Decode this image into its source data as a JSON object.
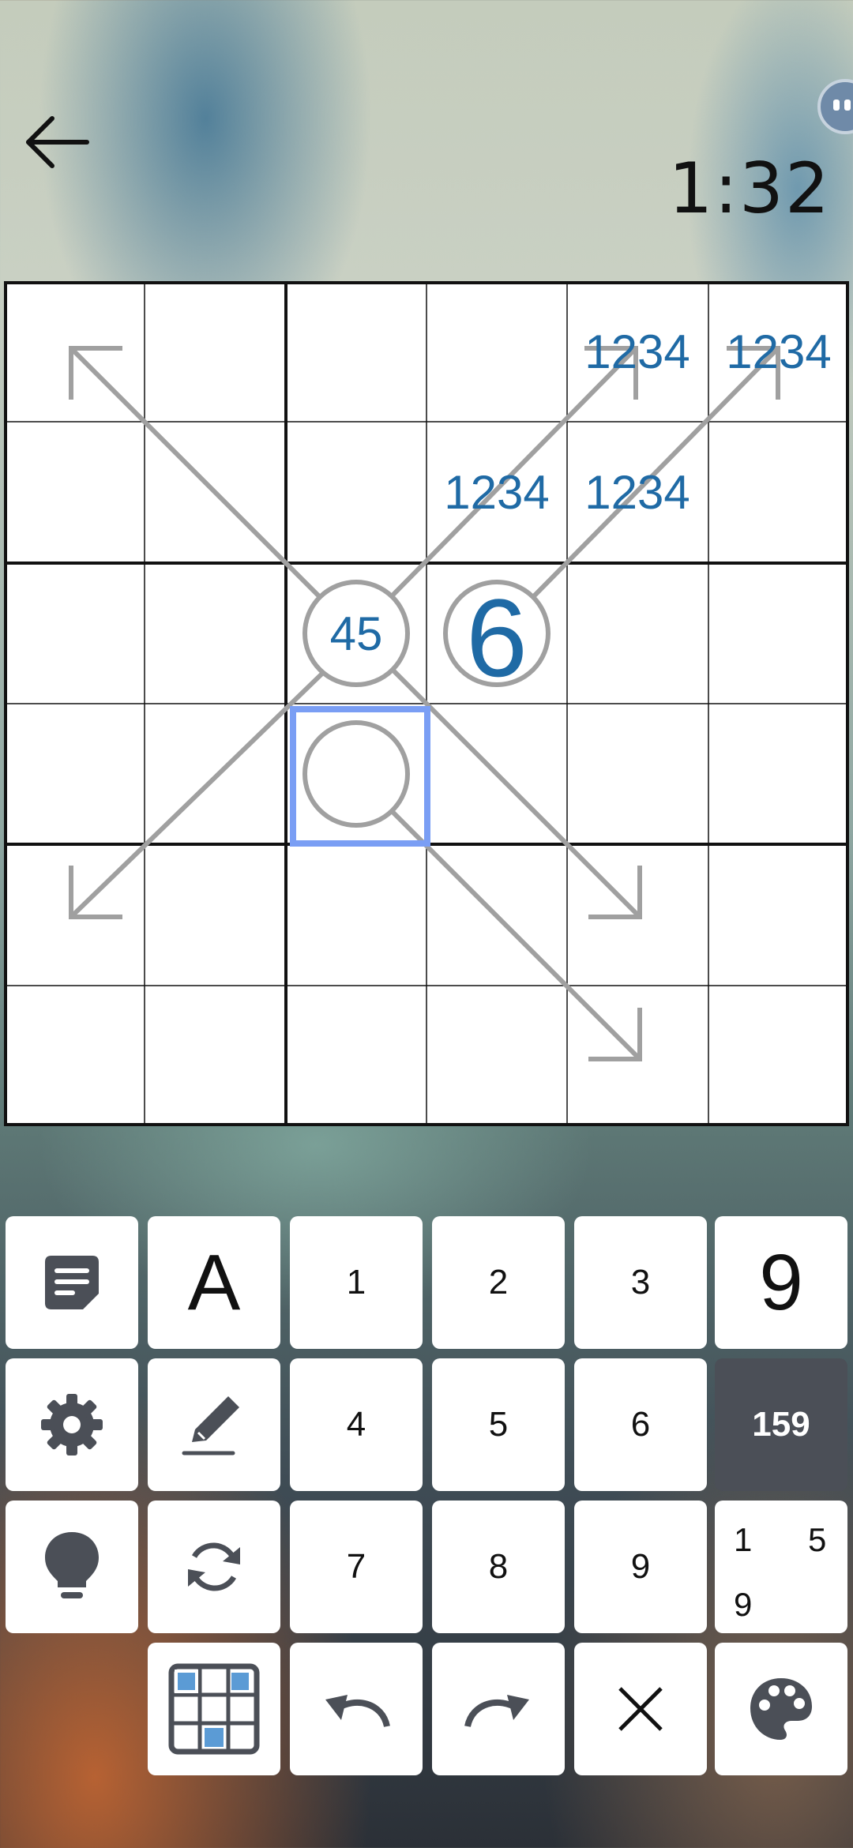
{
  "header": {
    "timer": "1:32",
    "back_icon": "arrow-left-icon",
    "avatar_icon": "robot-avatar-icon"
  },
  "board": {
    "size": 6,
    "cells": [
      {
        "row": 0,
        "col": 4,
        "notes": "1234"
      },
      {
        "row": 0,
        "col": 5,
        "notes": "1234"
      },
      {
        "row": 1,
        "col": 3,
        "notes": "1234"
      },
      {
        "row": 1,
        "col": 4,
        "notes": "1234"
      },
      {
        "row": 2,
        "col": 2,
        "notes": "45"
      },
      {
        "row": 2,
        "col": 3,
        "value": "6"
      }
    ],
    "circles": [
      {
        "row": 2,
        "col": 2
      },
      {
        "row": 2,
        "col": 3
      },
      {
        "row": 3,
        "col": 2
      }
    ],
    "arrows": [
      {
        "from": [
          2,
          2
        ],
        "to": [
          0,
          0
        ],
        "direction": "up-left"
      },
      {
        "from": [
          2,
          2
        ],
        "to": [
          0,
          4
        ],
        "direction": "up-right"
      },
      {
        "from": [
          2,
          3
        ],
        "to": [
          0,
          5
        ],
        "direction": "up-right"
      },
      {
        "from": [
          2,
          2
        ],
        "to": [
          4,
          0
        ],
        "direction": "down-left"
      },
      {
        "from": [
          2,
          2
        ],
        "to": [
          4,
          4
        ],
        "direction": "down-right"
      },
      {
        "from": [
          3,
          2
        ],
        "to": [
          5,
          4
        ],
        "direction": "down-right"
      }
    ],
    "selected_cell": {
      "row": 3,
      "col": 2
    },
    "colors": {
      "digit": "#1f6aa5",
      "arrow": "#a0a0a0",
      "selection": "#7a9ef4",
      "grid": "#111111"
    }
  },
  "keypad": {
    "row1": {
      "notes_icon": "note-icon",
      "letter_mode": "A",
      "digits": [
        "1",
        "2",
        "3"
      ],
      "nine_mode": "9"
    },
    "row2": {
      "settings_icon": "gear-icon",
      "pencil_icon": "pencil-icon",
      "digits": [
        "4",
        "5",
        "6"
      ],
      "mode_label": "159"
    },
    "row3": {
      "hint_icon": "lightbulb-icon",
      "restart_icon": "refresh-icon",
      "digits": [
        "7",
        "8",
        "9"
      ],
      "pencil_mode": [
        "1",
        "5",
        "9"
      ]
    },
    "row4": {
      "grid_icon": "grid-icon",
      "undo_icon": "undo-icon",
      "redo_icon": "redo-icon",
      "clear_icon": "close-icon",
      "palette_icon": "palette-icon"
    }
  }
}
